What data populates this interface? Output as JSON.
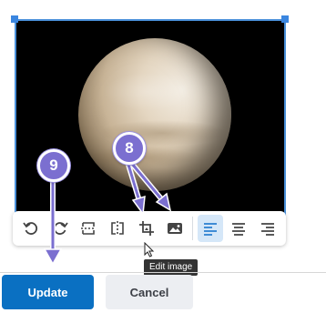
{
  "toolbar": {
    "buttons": [
      {
        "name": "undo",
        "icon": "undo-icon"
      },
      {
        "name": "redo",
        "icon": "redo-icon"
      },
      {
        "name": "flip-vertical",
        "icon": "flip-vertical-icon"
      },
      {
        "name": "flip-horizontal",
        "icon": "flip-horizontal-icon"
      },
      {
        "name": "crop",
        "icon": "crop-icon"
      },
      {
        "name": "edit-image",
        "icon": "image-icon"
      },
      {
        "name": "align-left",
        "icon": "align-left-icon",
        "active": true
      },
      {
        "name": "align-center",
        "icon": "align-center-icon"
      },
      {
        "name": "align-right",
        "icon": "align-right-icon"
      }
    ]
  },
  "tooltip": {
    "text": "Edit image"
  },
  "actions": {
    "update_label": "Update",
    "cancel_label": "Cancel"
  },
  "callouts": {
    "step_9": "9",
    "step_8": "8"
  },
  "colors": {
    "primary": "#0a70c2",
    "callout": "#7b6fd0",
    "selection": "#3a86e0",
    "active_tool_bg": "#d5e7f8"
  }
}
